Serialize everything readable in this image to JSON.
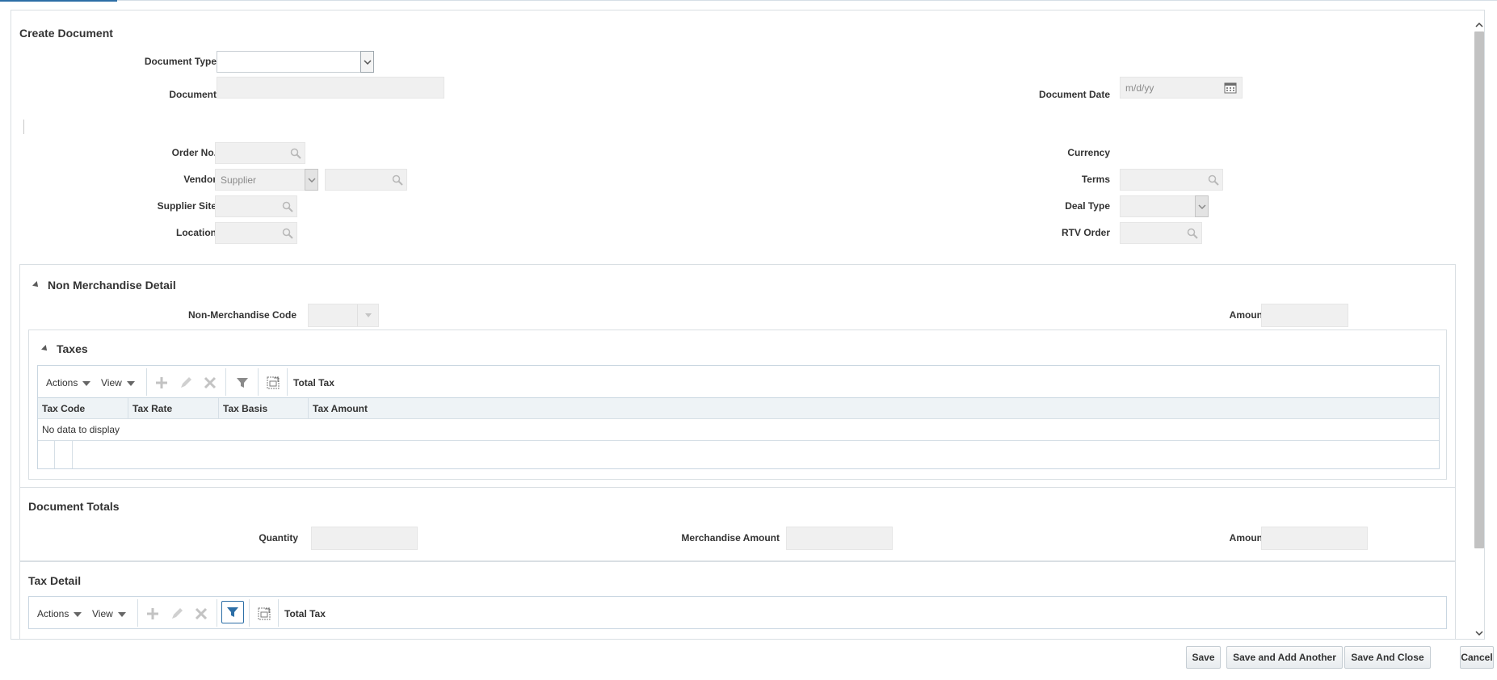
{
  "dialog": {
    "title": "Create Document",
    "fields": {
      "document_type": {
        "label": "Document Type",
        "value": ""
      },
      "document": {
        "label": "Document",
        "value": ""
      },
      "document_date": {
        "label": "Document Date",
        "placeholder": "m/d/yy"
      },
      "order_no": {
        "label": "Order No.",
        "value": ""
      },
      "vendor": {
        "label": "Vendor",
        "type_value": "Supplier",
        "value": ""
      },
      "supplier_site": {
        "label": "Supplier Site",
        "value": ""
      },
      "location": {
        "label": "Location",
        "value": ""
      },
      "currency": {
        "label": "Currency",
        "value": ""
      },
      "terms": {
        "label": "Terms",
        "value": ""
      },
      "deal_type": {
        "label": "Deal Type",
        "value": ""
      },
      "rtv_order": {
        "label": "RTV Order",
        "value": ""
      }
    }
  },
  "non_merch": {
    "title": "Non Merchandise Detail",
    "code_label": "Non-Merchandise Code",
    "amount_label": "Amount"
  },
  "taxes": {
    "title": "Taxes",
    "toolbar": {
      "actions": "Actions",
      "view": "View",
      "total_tax": "Total Tax"
    },
    "columns": [
      "Tax Code",
      "Tax Rate",
      "Tax Basis",
      "Tax Amount"
    ],
    "empty_text": "No data to display"
  },
  "totals": {
    "title": "Document Totals",
    "quantity_label": "Quantity",
    "merch_amount_label": "Merchandise Amount",
    "amount_label": "Amount"
  },
  "tax_detail": {
    "title": "Tax Detail",
    "toolbar": {
      "actions": "Actions",
      "view": "View",
      "total_tax": "Total Tax"
    }
  },
  "footer": {
    "save": "Save",
    "save_add": "Save and Add Another",
    "save_close": "Save And Close",
    "cancel": "Cancel"
  },
  "colors": {
    "accent": "#2c6ea6",
    "field_bg": "#f0f0f0",
    "border": "#d9dfe3"
  }
}
